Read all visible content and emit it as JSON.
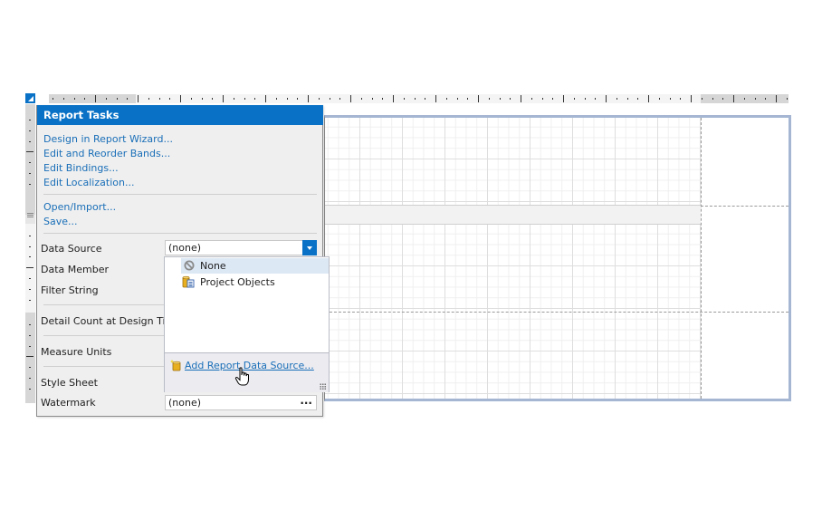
{
  "panel": {
    "title": "Report Tasks",
    "links_group1": [
      {
        "label": "Design in Report Wizard..."
      },
      {
        "label": "Edit and Reorder Bands..."
      },
      {
        "label": "Edit Bindings..."
      },
      {
        "label": "Edit Localization..."
      }
    ],
    "links_group2": [
      {
        "label": "Open/Import..."
      },
      {
        "label": "Save..."
      }
    ],
    "properties": {
      "data_source": {
        "label": "Data Source",
        "value": "(none)"
      },
      "data_member": {
        "label": "Data Member"
      },
      "filter_string": {
        "label": "Filter String"
      },
      "detail_count": {
        "label": "Detail Count at Design Time"
      },
      "measure_units": {
        "label": "Measure Units"
      },
      "style_sheet": {
        "label": "Style Sheet"
      },
      "watermark": {
        "label": "Watermark",
        "value": "(none)",
        "button": "..."
      }
    }
  },
  "dropdown": {
    "items": [
      {
        "label": "None",
        "icon": "no-entry-icon",
        "selected": true
      },
      {
        "label": "Project Objects",
        "icon": "database-icon",
        "selected": false
      }
    ],
    "footer_link": "Add Report Data Source..."
  },
  "colors": {
    "accent": "#0a72c6",
    "link": "#1a6fb8",
    "surface_border": "#a5b6d3",
    "selected_item": "#dde8f5"
  }
}
